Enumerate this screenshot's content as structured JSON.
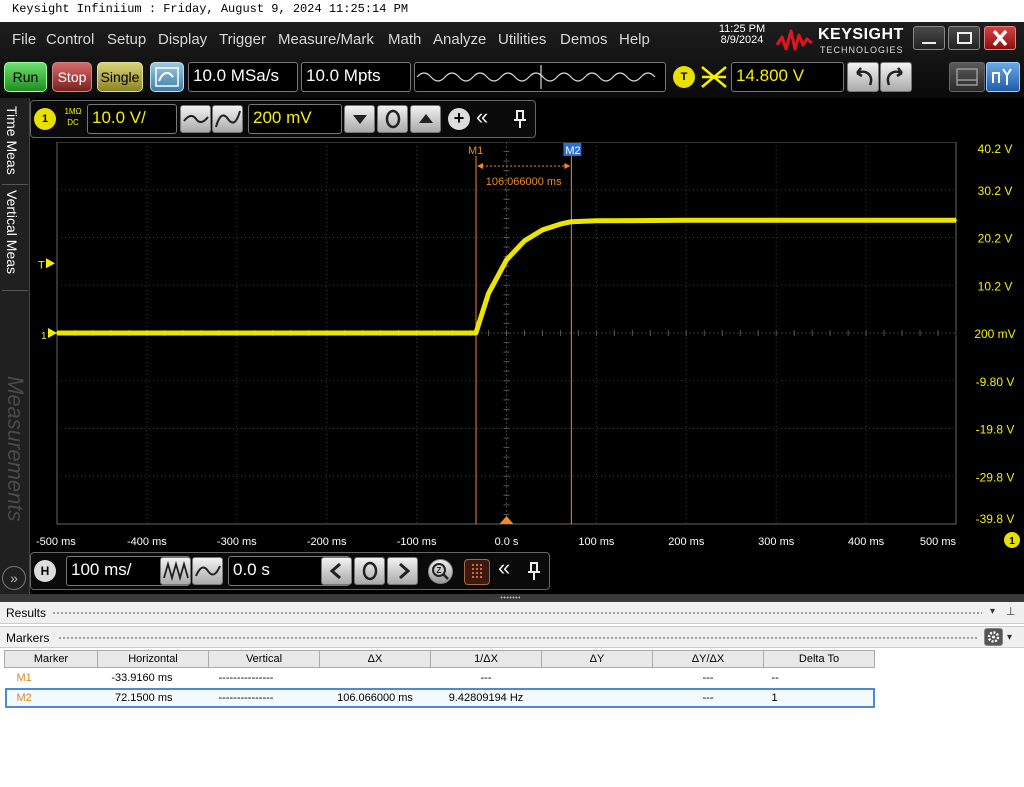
{
  "window_title": "Keysight Infiniium : Friday, August 9, 2024 11:25:14 PM",
  "menu": [
    "File",
    "Control",
    "Setup",
    "Display",
    "Trigger",
    "Measure/Mark",
    "Math",
    "Analyze",
    "Utilities",
    "Demos",
    "Help"
  ],
  "clock": {
    "time": "11:25 PM",
    "date": "8/9/2024"
  },
  "brand": {
    "name": "KEYSIGHT",
    "sub": "TECHNOLOGIES"
  },
  "toolbar": {
    "run": "Run",
    "stop": "Stop",
    "single": "Single",
    "sample_rate": "10.0 MSa/s",
    "memory_depth": "10.0 Mpts",
    "trigger_badge": "T",
    "trigger_level": "14.800 V"
  },
  "channel": {
    "badge": "1",
    "coupling_top": "1MΩ",
    "coupling_bottom": "DC",
    "scale": "10.0 V/",
    "offset": "200 mV"
  },
  "side_tabs": [
    "Time Meas",
    "Vertical Meas",
    "Measurements"
  ],
  "plot": {
    "trigger_marker": "T",
    "ground_marker": "1",
    "marker1_label": "M1",
    "marker2_label": "M2",
    "delta_label": "106.066000 ms",
    "y_ticks": [
      "40.2 V",
      "30.2 V",
      "20.2 V",
      "10.2 V",
      "200 mV",
      "-9.80 V",
      "-19.8 V",
      "-29.8 V",
      "-39.8 V"
    ],
    "x_ticks": [
      "-500 ms",
      "-400 ms",
      "-300 ms",
      "-200 ms",
      "-100 ms",
      "0.0 s",
      "100 ms",
      "200 ms",
      "300 ms",
      "400 ms",
      "500 ms"
    ],
    "channel_badge": "1",
    "trace_color": "#f5f000",
    "marker_color": "#f08a24"
  },
  "chart_data": {
    "type": "line",
    "xlabel": "",
    "ylabel": "",
    "xlim": [
      -500,
      500
    ],
    "ylim": [
      -39.8,
      40.2
    ],
    "x_unit": "ms",
    "y_unit": "V",
    "series": [
      {
        "x": [
          -500,
          -34,
          -20,
          0,
          20,
          40,
          60,
          72,
          100,
          200,
          300,
          400,
          500
        ],
        "values": [
          0.2,
          0.2,
          8.5,
          15.5,
          19.5,
          21.8,
          23.0,
          23.5,
          23.7,
          23.8,
          23.8,
          23.8,
          23.8
        ]
      }
    ],
    "markers": [
      {
        "label": "M1",
        "x": -33.916
      },
      {
        "label": "M2",
        "x": 72.15
      }
    ]
  },
  "timebase": {
    "badge": "H",
    "scale": "100 ms/",
    "delay": "0.0 s"
  },
  "results": {
    "title": "Results",
    "markers_title": "Markers",
    "columns": [
      "Marker",
      "Horizontal",
      "Vertical",
      "ΔX",
      "1/ΔX",
      "ΔY",
      "ΔY/ΔX",
      "Delta To"
    ],
    "rows": [
      [
        "M1",
        "-33.9160 ms",
        "---------------",
        "",
        "---",
        "",
        "---",
        "--"
      ],
      [
        "M2",
        "72.1500 ms",
        "---------------",
        "106.066000 ms",
        "9.42809194 Hz",
        "",
        "---",
        "1"
      ]
    ]
  }
}
